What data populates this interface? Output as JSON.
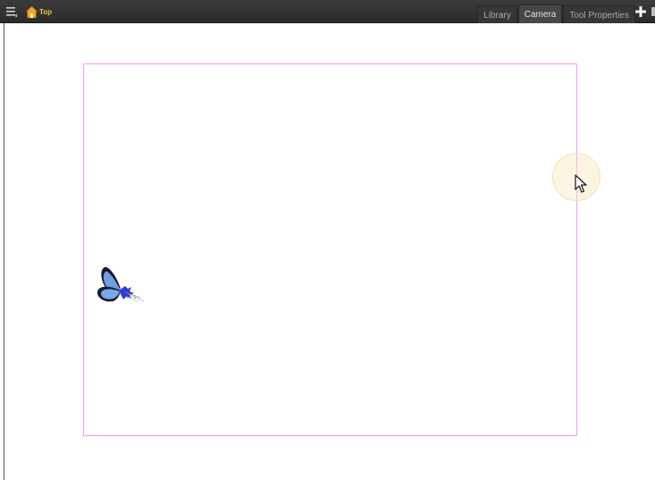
{
  "header": {
    "menu_icon": "hamburger-menu-icon",
    "breadcrumb": {
      "icon": "home-icon",
      "label": "Top"
    }
  },
  "tabs": [
    {
      "label": "Library",
      "active": false
    },
    {
      "label": "Camera",
      "active": true
    },
    {
      "label": "Tool Properties",
      "active": false
    }
  ],
  "tab_actions": {
    "add_icon": "plus-icon"
  },
  "viewport": {
    "frame_color": "#f0a2f0",
    "objects": [
      {
        "name": "butterfly",
        "colors": [
          "#1a1a2e",
          "#6a9be0",
          "#2f3ad8"
        ]
      }
    ]
  },
  "cursor": {
    "icon": "arrow-cursor-icon"
  }
}
